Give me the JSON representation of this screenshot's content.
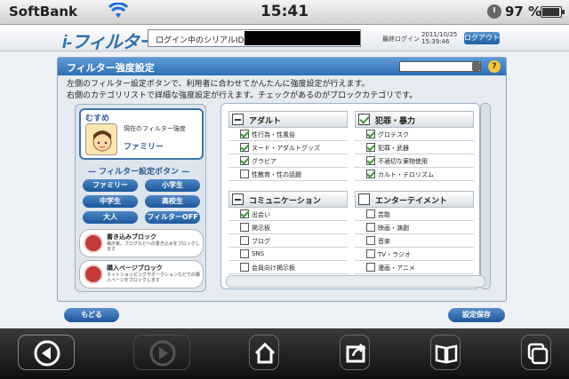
{
  "status_bar": {
    "carrier": "SoftBank",
    "time": "15:41",
    "battery": "97 %",
    "battery_level": 0.97
  },
  "header": {
    "logo": "i-フィルター",
    "serial_label": "ログイン中のシリアルID：",
    "last_login_label": "最終ログイン",
    "last_login_date": "2011/10/25",
    "last_login_time": "15:39:46",
    "logout_button": "ログアウト"
  },
  "panel": {
    "title": "フィルター強度設定",
    "description_line1": "左側のフィルター設定ボタンで、利用者に合わせてかんたんに強度設定が行えます。",
    "description_line2": "右側のカテゴリリストで詳細な強度設定が行えます。チェックがあるのがブロックカテゴリです。"
  },
  "recommend": {
    "tag": "むすめ",
    "label": "現在のフィルター強度",
    "value": "ファミリー"
  },
  "filter_buttons": {
    "heading": "フィルター設定ボタン",
    "family": "ファミリー",
    "elementary": "小学生",
    "junior_high": "中学生",
    "high_school": "高校生",
    "adult": "大人",
    "off": "フィルターOFF"
  },
  "blocks": {
    "write_title": "書き込みブロック",
    "write_desc": "掲示板、ブログなどへの書き込みをブロックします",
    "purchase_title": "購入ページブロック",
    "purchase_desc": "ネットショッピングやオークションなどでの購入ページをブロックします"
  },
  "categories": {
    "adult": {
      "title": "アダルト",
      "state": "partial",
      "items": [
        {
          "label": "性行為・性風俗",
          "checked": true
        },
        {
          "label": "ヌード・アダルトグッズ",
          "checked": true
        },
        {
          "label": "グラビア",
          "checked": true
        },
        {
          "label": "性教育・性の話題",
          "checked": false
        }
      ]
    },
    "crime": {
      "title": "犯罪・暴力",
      "state": "checked",
      "items": [
        {
          "label": "グロテスク",
          "checked": true
        },
        {
          "label": "犯罪・武器",
          "checked": true
        },
        {
          "label": "不適切な薬物使用",
          "checked": true
        },
        {
          "label": "カルト・テロリズム",
          "checked": true
        }
      ]
    },
    "communication": {
      "title": "コミュニケーション",
      "state": "partial",
      "items": [
        {
          "label": "出会い",
          "checked": true
        },
        {
          "label": "掲示板",
          "checked": false
        },
        {
          "label": "ブログ",
          "checked": false
        },
        {
          "label": "SNS",
          "checked": false
        },
        {
          "label": "会員向け掲示板",
          "checked": false
        }
      ]
    },
    "entertainment": {
      "title": "エンターテイメント",
      "state": "unchecked",
      "items": [
        {
          "label": "芸能",
          "checked": false
        },
        {
          "label": "映画・演劇",
          "checked": false
        },
        {
          "label": "音楽",
          "checked": false
        },
        {
          "label": "TV・ラジオ",
          "checked": false
        },
        {
          "label": "漫画・アニメ",
          "checked": false
        }
      ]
    }
  },
  "actions": {
    "back": "もどる",
    "save": "設定保存"
  },
  "toolbar_icons": [
    "back-arrow-icon",
    "forward-arrow-icon",
    "home-icon",
    "share-icon",
    "bookmarks-icon",
    "tabs-icon"
  ]
}
